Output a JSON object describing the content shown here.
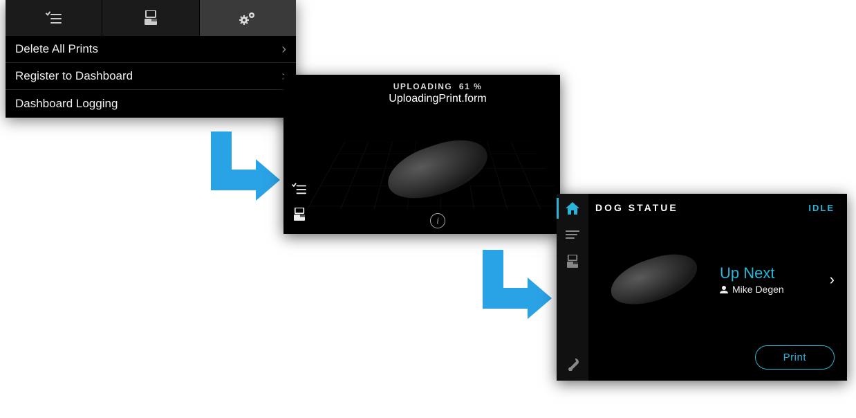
{
  "panel1": {
    "tabs": [
      {
        "icon": "checklist-icon"
      },
      {
        "icon": "printer-icon"
      },
      {
        "icon": "gears-icon",
        "active": true
      }
    ],
    "items": [
      {
        "label": "Delete All Prints",
        "arrow": true
      },
      {
        "label": "Register to Dashboard",
        "arrow": true
      },
      {
        "label": "Dashboard Logging",
        "arrow": false
      }
    ]
  },
  "panel2": {
    "status_label": "UPLOADING",
    "status_percent": "61 %",
    "filename": "UploadingPrint.form",
    "side_icons": [
      "checklist-icon",
      "printer-icon"
    ],
    "info_icon": "info-icon"
  },
  "panel3": {
    "side_icons": [
      "home-icon",
      "list-icon",
      "printer-icon",
      "wrench-icon"
    ],
    "title": "DOG STATUE",
    "status": "IDLE",
    "upnext_label": "Up Next",
    "user_name": "Mike Degen",
    "print_button": "Print"
  }
}
